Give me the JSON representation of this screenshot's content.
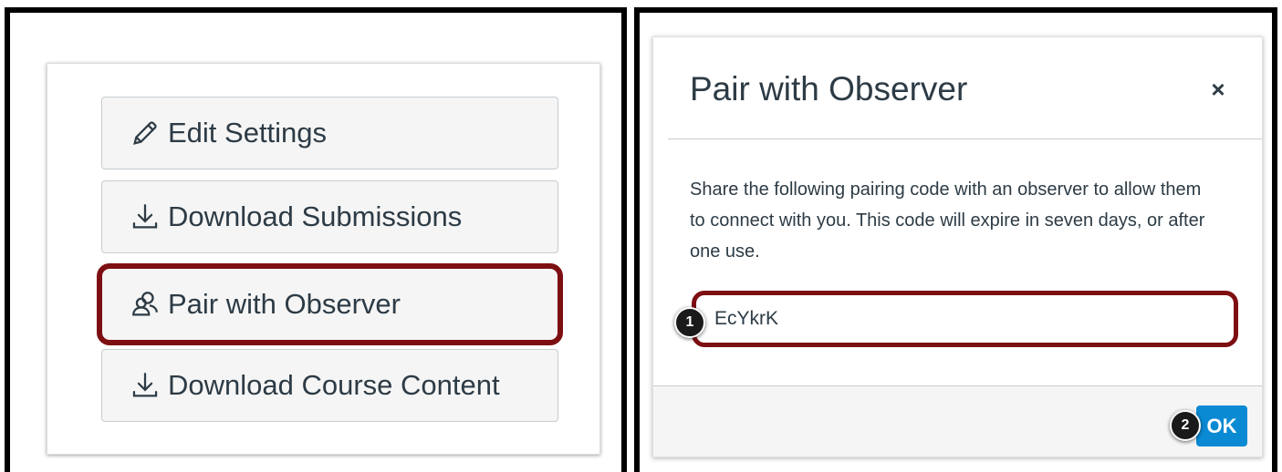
{
  "settings_card": {
    "buttons": [
      {
        "label": "Edit Settings",
        "icon": "pencil-icon"
      },
      {
        "label": "Download Submissions",
        "icon": "download-icon"
      },
      {
        "label": "Pair with Observer",
        "icon": "users-icon",
        "highlighted": true
      },
      {
        "label": "Download Course Content",
        "icon": "download-icon"
      }
    ],
    "highlight_color": "#7d0f12"
  },
  "modal": {
    "title": "Pair with Observer",
    "close_glyph": "×",
    "body_text": "Share the following pairing code with an observer to allow them to connect with you. This code will expire in seven days, or after one use.",
    "pairing_code": "EcYkrK",
    "ok_label": "OK",
    "ok_color": "#0a8ad3"
  },
  "callouts": [
    "1",
    "2"
  ]
}
